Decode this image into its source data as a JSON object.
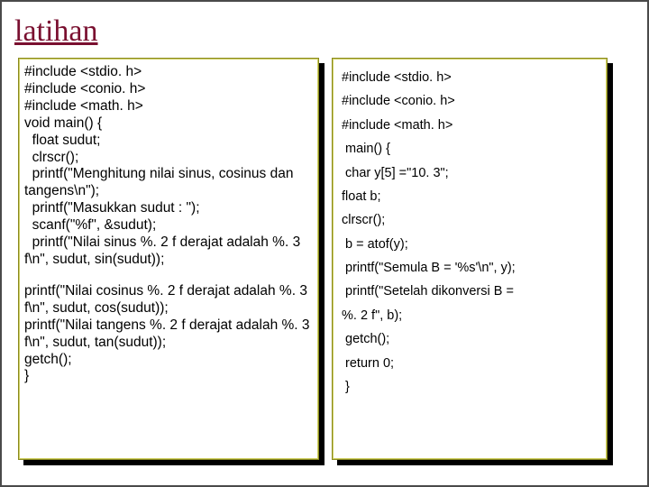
{
  "title": "latihan",
  "left_code": "#include <stdio. h>\n#include <conio. h>\n#include <math. h>\nvoid main() {\n  float sudut;\n  clrscr();\n  printf(\"Menghitung nilai sinus, cosinus dan tangens\\n\");\n  printf(\"Masukkan sudut : \");\n  scanf(\"%f\", &sudut);\n  printf(\"Nilai sinus %. 2 f derajat adalah %. 3 f\\n\", sudut, sin(sudut));",
  "left_code2": "printf(\"Nilai cosinus %. 2 f derajat adalah %. 3 f\\n\", sudut, cos(sudut));\nprintf(\"Nilai tangens %. 2 f derajat adalah %. 3 f\\n\", sudut, tan(sudut));\ngetch();\n}",
  "right_lines": [
    "#include <stdio. h>",
    "#include <conio. h>",
    "#include <math. h>",
    " main() {",
    " char y[5] =\"10. 3\";",
    "float b;",
    "clrscr();",
    " b = atof(y);",
    " printf(\"Semula B = '%s'\\n\", y);",
    " printf(\"Setelah dikonversi B =",
    "%. 2 f\", b);",
    " getch();",
    " return 0;",
    " }"
  ]
}
